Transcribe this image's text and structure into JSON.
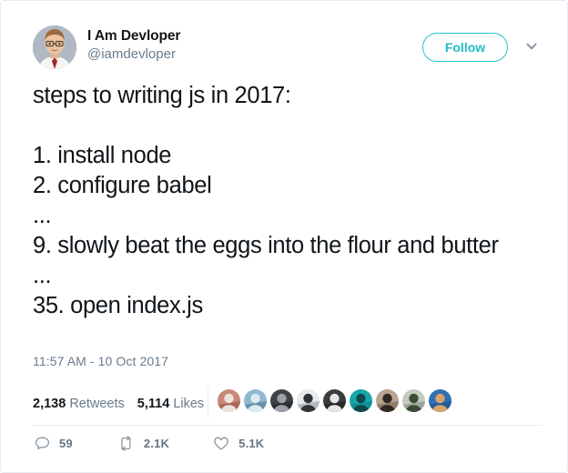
{
  "card": {
    "border_color": "#e6ecf0",
    "background": "#ffffff"
  },
  "author": {
    "display_name": "I Am Devloper",
    "handle": "@iamdevloper",
    "avatar_icon": "user-photo-avatar"
  },
  "header": {
    "follow_label": "Follow",
    "follow_color": "#1fbfc4",
    "caret_icon": "chevron-down-icon"
  },
  "tweet": {
    "text": "steps to writing js in 2017:\n\n1. install node\n2. configure babel\n...\n9. slowly beat the eggs into the flour and butter\n...\n35. open index.js",
    "timestamp": "11:57 AM - 10 Oct 2017"
  },
  "stats": {
    "retweets_value": "2,138",
    "retweets_label": "Retweets",
    "likes_value": "5,114",
    "likes_label": "Likes"
  },
  "facepile": {
    "avatar_icon": "user-photo-avatar",
    "faces": [
      {
        "name": "liker-avatar-1",
        "bg": "#c8897a",
        "fg": "#f0e3dc",
        "accent": "#8f4e3d"
      },
      {
        "name": "liker-avatar-2",
        "bg": "#8fb9cf",
        "fg": "#dceaf2",
        "accent": "#45708c"
      },
      {
        "name": "liker-avatar-3",
        "bg": "#3f4347",
        "fg": "#9ba1a6",
        "accent": "#202325"
      },
      {
        "name": "liker-avatar-4",
        "bg": "#e7e9ea",
        "fg": "#2f3336",
        "accent": "#8a9199"
      },
      {
        "name": "liker-avatar-5",
        "bg": "#3a3d40",
        "fg": "#e4e6e7",
        "accent": "#17191a"
      },
      {
        "name": "liker-avatar-6",
        "bg": "#16a6a8",
        "fg": "#10484d",
        "accent": "#0c7f82"
      },
      {
        "name": "liker-avatar-7",
        "bg": "#b9a48e",
        "fg": "#2e2722",
        "accent": "#6d5c4b"
      },
      {
        "name": "liker-avatar-8",
        "bg": "#c3cbbf",
        "fg": "#3c4a3a",
        "accent": "#7d8a79"
      },
      {
        "name": "liker-avatar-9",
        "bg": "#2f6fb5",
        "fg": "#d9a36a",
        "accent": "#1d4a7d"
      }
    ]
  },
  "actions": {
    "reply_icon": "reply-bubble-icon",
    "reply_count": "59",
    "retweet_icon": "retweet-icon",
    "retweet_count": "2.1K",
    "like_icon": "heart-icon",
    "like_count": "5.1K",
    "icon_color": "#66757f"
  }
}
